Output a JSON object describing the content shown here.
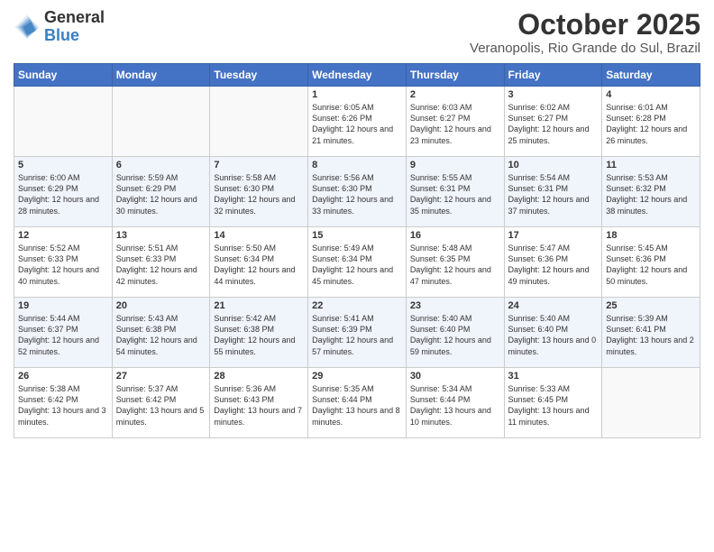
{
  "header": {
    "logo_general": "General",
    "logo_blue": "Blue",
    "month": "October 2025",
    "location": "Veranopolis, Rio Grande do Sul, Brazil"
  },
  "weekdays": [
    "Sunday",
    "Monday",
    "Tuesday",
    "Wednesday",
    "Thursday",
    "Friday",
    "Saturday"
  ],
  "weeks": [
    [
      {
        "day": "",
        "info": ""
      },
      {
        "day": "",
        "info": ""
      },
      {
        "day": "",
        "info": ""
      },
      {
        "day": "1",
        "info": "Sunrise: 6:05 AM\nSunset: 6:26 PM\nDaylight: 12 hours\nand 21 minutes."
      },
      {
        "day": "2",
        "info": "Sunrise: 6:03 AM\nSunset: 6:27 PM\nDaylight: 12 hours\nand 23 minutes."
      },
      {
        "day": "3",
        "info": "Sunrise: 6:02 AM\nSunset: 6:27 PM\nDaylight: 12 hours\nand 25 minutes."
      },
      {
        "day": "4",
        "info": "Sunrise: 6:01 AM\nSunset: 6:28 PM\nDaylight: 12 hours\nand 26 minutes."
      }
    ],
    [
      {
        "day": "5",
        "info": "Sunrise: 6:00 AM\nSunset: 6:29 PM\nDaylight: 12 hours\nand 28 minutes."
      },
      {
        "day": "6",
        "info": "Sunrise: 5:59 AM\nSunset: 6:29 PM\nDaylight: 12 hours\nand 30 minutes."
      },
      {
        "day": "7",
        "info": "Sunrise: 5:58 AM\nSunset: 6:30 PM\nDaylight: 12 hours\nand 32 minutes."
      },
      {
        "day": "8",
        "info": "Sunrise: 5:56 AM\nSunset: 6:30 PM\nDaylight: 12 hours\nand 33 minutes."
      },
      {
        "day": "9",
        "info": "Sunrise: 5:55 AM\nSunset: 6:31 PM\nDaylight: 12 hours\nand 35 minutes."
      },
      {
        "day": "10",
        "info": "Sunrise: 5:54 AM\nSunset: 6:31 PM\nDaylight: 12 hours\nand 37 minutes."
      },
      {
        "day": "11",
        "info": "Sunrise: 5:53 AM\nSunset: 6:32 PM\nDaylight: 12 hours\nand 38 minutes."
      }
    ],
    [
      {
        "day": "12",
        "info": "Sunrise: 5:52 AM\nSunset: 6:33 PM\nDaylight: 12 hours\nand 40 minutes."
      },
      {
        "day": "13",
        "info": "Sunrise: 5:51 AM\nSunset: 6:33 PM\nDaylight: 12 hours\nand 42 minutes."
      },
      {
        "day": "14",
        "info": "Sunrise: 5:50 AM\nSunset: 6:34 PM\nDaylight: 12 hours\nand 44 minutes."
      },
      {
        "day": "15",
        "info": "Sunrise: 5:49 AM\nSunset: 6:34 PM\nDaylight: 12 hours\nand 45 minutes."
      },
      {
        "day": "16",
        "info": "Sunrise: 5:48 AM\nSunset: 6:35 PM\nDaylight: 12 hours\nand 47 minutes."
      },
      {
        "day": "17",
        "info": "Sunrise: 5:47 AM\nSunset: 6:36 PM\nDaylight: 12 hours\nand 49 minutes."
      },
      {
        "day": "18",
        "info": "Sunrise: 5:45 AM\nSunset: 6:36 PM\nDaylight: 12 hours\nand 50 minutes."
      }
    ],
    [
      {
        "day": "19",
        "info": "Sunrise: 5:44 AM\nSunset: 6:37 PM\nDaylight: 12 hours\nand 52 minutes."
      },
      {
        "day": "20",
        "info": "Sunrise: 5:43 AM\nSunset: 6:38 PM\nDaylight: 12 hours\nand 54 minutes."
      },
      {
        "day": "21",
        "info": "Sunrise: 5:42 AM\nSunset: 6:38 PM\nDaylight: 12 hours\nand 55 minutes."
      },
      {
        "day": "22",
        "info": "Sunrise: 5:41 AM\nSunset: 6:39 PM\nDaylight: 12 hours\nand 57 minutes."
      },
      {
        "day": "23",
        "info": "Sunrise: 5:40 AM\nSunset: 6:40 PM\nDaylight: 12 hours\nand 59 minutes."
      },
      {
        "day": "24",
        "info": "Sunrise: 5:40 AM\nSunset: 6:40 PM\nDaylight: 13 hours\nand 0 minutes."
      },
      {
        "day": "25",
        "info": "Sunrise: 5:39 AM\nSunset: 6:41 PM\nDaylight: 13 hours\nand 2 minutes."
      }
    ],
    [
      {
        "day": "26",
        "info": "Sunrise: 5:38 AM\nSunset: 6:42 PM\nDaylight: 13 hours\nand 3 minutes."
      },
      {
        "day": "27",
        "info": "Sunrise: 5:37 AM\nSunset: 6:42 PM\nDaylight: 13 hours\nand 5 minutes."
      },
      {
        "day": "28",
        "info": "Sunrise: 5:36 AM\nSunset: 6:43 PM\nDaylight: 13 hours\nand 7 minutes."
      },
      {
        "day": "29",
        "info": "Sunrise: 5:35 AM\nSunset: 6:44 PM\nDaylight: 13 hours\nand 8 minutes."
      },
      {
        "day": "30",
        "info": "Sunrise: 5:34 AM\nSunset: 6:44 PM\nDaylight: 13 hours\nand 10 minutes."
      },
      {
        "day": "31",
        "info": "Sunrise: 5:33 AM\nSunset: 6:45 PM\nDaylight: 13 hours\nand 11 minutes."
      },
      {
        "day": "",
        "info": ""
      }
    ]
  ]
}
